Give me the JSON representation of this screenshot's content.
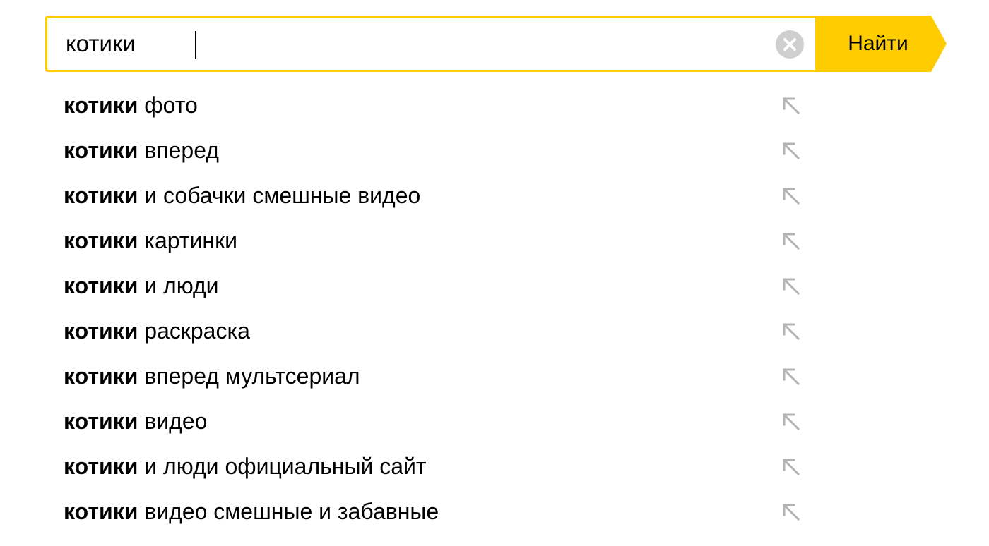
{
  "search": {
    "value": "котики",
    "find_label": "Найти",
    "accent_color": "#ffcc00"
  },
  "suggestions": [
    {
      "bold": "котики",
      "rest": "фото"
    },
    {
      "bold": "котики",
      "rest": "вперед"
    },
    {
      "bold": "котики",
      "rest": "и собачки смешные видео"
    },
    {
      "bold": "котики",
      "rest": "картинки"
    },
    {
      "bold": "котики",
      "rest": "и люди"
    },
    {
      "bold": "котики",
      "rest": "раскраска"
    },
    {
      "bold": "котики",
      "rest": "вперед мультсериал"
    },
    {
      "bold": "котики",
      "rest": "видео"
    },
    {
      "bold": "котики",
      "rest": "и люди официальный сайт"
    },
    {
      "bold": "котики",
      "rest": "видео смешные и забавные"
    }
  ],
  "icons": {
    "clear": "clear-icon",
    "insert_suggestion": "arrow-up-left-icon"
  }
}
